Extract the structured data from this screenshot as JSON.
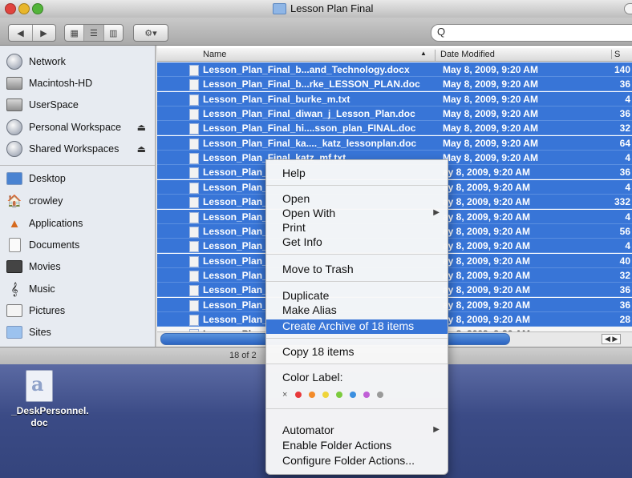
{
  "window": {
    "title": "Lesson Plan Final",
    "search_value": "Q",
    "status": "18 of 2"
  },
  "sidebar": {
    "devices": [
      {
        "label": "Network",
        "icon": "network-globe-icon",
        "eject": ""
      },
      {
        "label": "Macintosh-HD",
        "icon": "hard-drive-icon",
        "eject": ""
      },
      {
        "label": "UserSpace",
        "icon": "hard-drive-icon",
        "eject": ""
      },
      {
        "label": "Personal Workspace",
        "icon": "network-globe-icon",
        "eject": "⏏"
      },
      {
        "label": "Shared Workspaces",
        "icon": "network-globe-icon",
        "eject": "⏏"
      }
    ],
    "places": [
      {
        "label": "Desktop",
        "icon": "desktop-icon"
      },
      {
        "label": "crowley",
        "icon": "home-icon"
      },
      {
        "label": "Applications",
        "icon": "applications-icon"
      },
      {
        "label": "Documents",
        "icon": "documents-icon"
      },
      {
        "label": "Movies",
        "icon": "movies-icon"
      },
      {
        "label": "Music",
        "icon": "music-icon"
      },
      {
        "label": "Pictures",
        "icon": "pictures-icon"
      },
      {
        "label": "Sites",
        "icon": "sites-icon"
      }
    ]
  },
  "columns": {
    "name": "Name",
    "date": "Date Modified",
    "size": "S"
  },
  "files": [
    {
      "name": "Lesson_Plan_Final_b...and_Technology.docx",
      "date": "May 8, 2009, 9:20 AM",
      "size": "140"
    },
    {
      "name": "Lesson_Plan_Final_b...rke_LESSON_PLAN.doc",
      "date": "May 8, 2009, 9:20 AM",
      "size": "36"
    },
    {
      "name": "Lesson_Plan_Final_burke_m.txt",
      "date": "May 8, 2009, 9:20 AM",
      "size": "4"
    },
    {
      "name": "Lesson_Plan_Final_diwan_j_Lesson_Plan.doc",
      "date": "May 8, 2009, 9:20 AM",
      "size": "36"
    },
    {
      "name": "Lesson_Plan_Final_hi....sson_plan_FINAL.doc",
      "date": "May 8, 2009, 9:20 AM",
      "size": "32"
    },
    {
      "name": "Lesson_Plan_Final_ka...._katz_lessonplan.doc",
      "date": "May 8, 2009, 9:20 AM",
      "size": "64"
    },
    {
      "name": "Lesson_Plan_Final_katz_mf.txt",
      "date": "May 8, 2009, 9:20 AM",
      "size": "4"
    },
    {
      "name": "Lesson_Plan_",
      "date": "ay 8, 2009, 9:20 AM",
      "size": "36"
    },
    {
      "name": "Lesson_Plan_",
      "date": "ay 8, 2009, 9:20 AM",
      "size": "4"
    },
    {
      "name": "Lesson_Plan_",
      "date": "ay 8, 2009, 9:20 AM",
      "size": "332"
    },
    {
      "name": "Lesson_Plan_",
      "date": "ay 8, 2009, 9:20 AM",
      "size": "4"
    },
    {
      "name": "Lesson_Plan_",
      "date": "ay 8, 2009, 9:20 AM",
      "size": "56"
    },
    {
      "name": "Lesson_Plan_",
      "date": "ay 8, 2009, 9:20 AM",
      "size": "4"
    },
    {
      "name": "Lesson_Plan_",
      "date": "ay 8, 2009, 9:20 AM",
      "size": "40"
    },
    {
      "name": "Lesson_Plan_",
      "date": "ay 8, 2009, 9:20 AM",
      "size": "32"
    },
    {
      "name": "Lesson_Plan_",
      "date": "ay 8, 2009, 9:20 AM",
      "size": "36"
    },
    {
      "name": "Lesson_Plan_",
      "date": "ay 8, 2009, 9:20 AM",
      "size": "36"
    },
    {
      "name": "Lesson_Plan_",
      "date": "ay 8, 2009, 9:20 AM",
      "size": "28"
    },
    {
      "name": "Lesson_Plan",
      "date": "ay 8, 2009, 9:20 AM",
      "size": ""
    }
  ],
  "context_menu": {
    "help": "Help",
    "open": "Open",
    "open_with": "Open With",
    "print": "Print",
    "get_info": "Get Info",
    "move_to_trash": "Move to Trash",
    "duplicate": "Duplicate",
    "make_alias": "Make Alias",
    "create_archive": "Create Archive of 18 items",
    "copy": "Copy 18 items",
    "color_label": "Color Label:",
    "color_none": "×",
    "colors": [
      "#e8393b",
      "#f38b2a",
      "#efd43a",
      "#7ccb3e",
      "#3b8fe0",
      "#c05fd6",
      "#9a9a9a"
    ],
    "automator": "Automator",
    "enable_folder_actions": "Enable Folder Actions",
    "configure_folder_actions": "Configure Folder Actions..."
  },
  "desktop": {
    "file_label": "_DeskPersonnel.\ndoc"
  }
}
